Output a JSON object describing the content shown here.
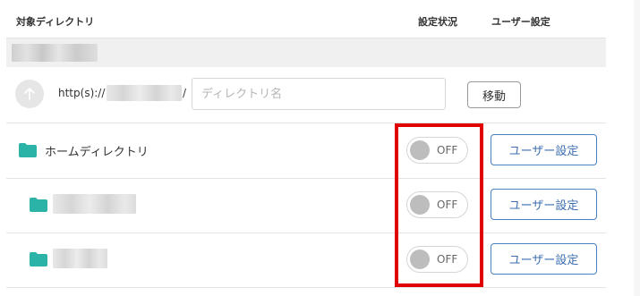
{
  "header": {
    "target_directory": "対象ディレクトリ",
    "setting_status": "設定状況",
    "user_settings": "ユーザー設定"
  },
  "nav": {
    "up_icon": "arrow-up-icon",
    "url_prefix": "http(s)://",
    "url_slash": "/",
    "directory_input_placeholder": "ディレクトリ名",
    "directory_input_value": "",
    "move_button": "移動"
  },
  "rows": [
    {
      "name": "ホームディレクトリ",
      "toggle_label": "OFF",
      "user_button": "ユーザー設定"
    },
    {
      "name": "",
      "toggle_label": "OFF",
      "user_button": "ユーザー設定"
    },
    {
      "name": "",
      "toggle_label": "OFF",
      "user_button": "ユーザー設定"
    }
  ],
  "colors": {
    "folder": "#2ab3a6",
    "button_border": "#4a7fc1",
    "highlight": "#e00000",
    "toggle_knob": "#bdbdbd"
  },
  "icons": {
    "folder": "folder-icon"
  }
}
